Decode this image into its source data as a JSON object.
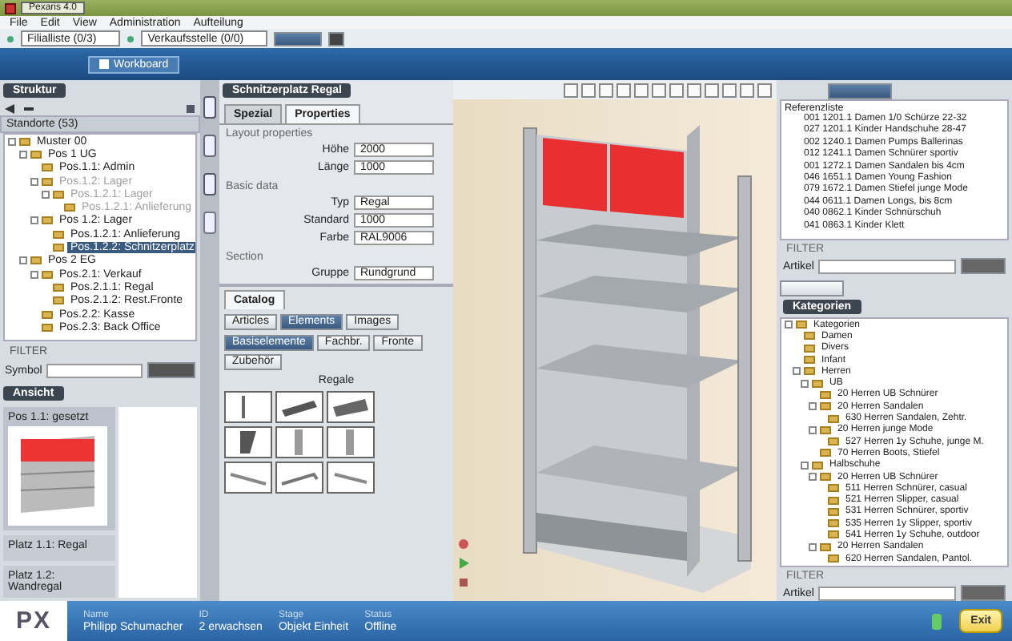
{
  "window": {
    "title": "Pexaris 4.0"
  },
  "menu": [
    "File",
    "Edit",
    "View",
    "Administration",
    "Aufteilung"
  ],
  "toolbar": {
    "dropdowns": [
      "Filialliste (0/3)",
      "Verkaufsstelle (0/0)"
    ],
    "workboard": "Workboard"
  },
  "left_panel": {
    "header": "Struktur",
    "tree_header": "Standorte (53)",
    "tree": [
      {
        "label": "Muster 00",
        "selected": false,
        "disabled": false,
        "children": [
          {
            "label": "Pos 1 UG",
            "selected": false,
            "disabled": false,
            "children": [
              {
                "label": "Pos.1.1: Admin",
                "selected": false,
                "disabled": false
              },
              {
                "label": "Pos.1.2: Lager",
                "selected": false,
                "disabled": true,
                "children": [
                  {
                    "label": "Pos.1.2.1: Lager",
                    "selected": false,
                    "disabled": true,
                    "children": [
                      {
                        "label": "Pos.1.2.1: Anlieferung",
                        "selected": false,
                        "disabled": true
                      }
                    ]
                  }
                ]
              },
              {
                "label": "Pos 1.2: Lager",
                "selected": false,
                "disabled": false,
                "children": [
                  {
                    "label": "Pos.1.2.1: Anlieferung",
                    "selected": false,
                    "disabled": false
                  },
                  {
                    "label": "Pos.1.2.2: Schnitzerplatz",
                    "selected": true,
                    "disabled": false
                  }
                ]
              }
            ]
          },
          {
            "label": "Pos 2 EG",
            "selected": false,
            "disabled": false,
            "children": [
              {
                "label": "Pos.2.1: Verkauf",
                "selected": false,
                "disabled": false,
                "children": [
                  {
                    "label": "Pos.2.1.1: Regal",
                    "selected": false,
                    "disabled": false
                  },
                  {
                    "label": "Pos.2.1.2: Rest.Fronte",
                    "selected": false,
                    "disabled": false
                  }
                ]
              },
              {
                "label": "Pos.2.2: Kasse",
                "selected": false,
                "disabled": false
              },
              {
                "label": "Pos.2.3: Back Office",
                "selected": false,
                "disabled": false
              }
            ]
          }
        ]
      }
    ],
    "filter": {
      "title": "FILTER",
      "label": "Symbol"
    },
    "thumbs_header": "Ansicht",
    "thumbnails": [
      {
        "label": "Pos 1.1: gesetzt",
        "selected": true
      },
      {
        "label": "Platz 1.1: Regal",
        "selected": false
      },
      {
        "label": "Platz 1.2: Wandregal",
        "selected": false
      }
    ]
  },
  "properties": {
    "title": "Schnitzerplatz Regal",
    "tabs": [
      {
        "label": "Spezial",
        "selected": false
      },
      {
        "label": "Properties",
        "selected": true
      }
    ],
    "sections": [
      {
        "title": "Layout properties",
        "fields": [
          {
            "label": "Höhe",
            "value": "2000"
          },
          {
            "label": "Länge",
            "value": "1000"
          }
        ]
      },
      {
        "title": "Basic data",
        "fields": [
          {
            "label": "Typ",
            "value": "Regal"
          },
          {
            "label": "Standard",
            "value": "1000"
          },
          {
            "label": "Farbe",
            "value": "RAL9006"
          }
        ]
      },
      {
        "title": "Section",
        "fields": [
          {
            "label": "Gruppe",
            "value": "Rundgrund"
          }
        ]
      }
    ]
  },
  "catalog": {
    "title": "Catalog",
    "tabs": [
      {
        "label": "Articles",
        "selected": false
      },
      {
        "label": "Elements",
        "selected": true
      },
      {
        "label": "Images",
        "selected": false
      }
    ],
    "filters": [
      {
        "label": "Basiselemente",
        "selected": true
      },
      {
        "label": "Fachbr.",
        "selected": false
      },
      {
        "label": "Fronte",
        "selected": false
      },
      {
        "label": "Zubehör",
        "selected": false
      }
    ],
    "group": "Regale"
  },
  "right_panel": {
    "list_header": "Referenzliste",
    "list": [
      "001 1201.1 Damen 1/0 Schürze 22-32",
      "027 1201.1 Kinder Handschuhe 28-47",
      "002 1240.1 Damen Pumps Ballerinas",
      "012 1241.1 Damen Schnürer sportiv",
      "001 1272.1 Damen Sandalen bis 4cm",
      "046 1651.1 Damen Young Fashion",
      "079 1672.1 Damen Stiefel junge Mode",
      "044 0611.1 Damen Longs, bis 8cm",
      "040 0862.1 Kinder Schnürschuh",
      "041 0863.1 Kinder Klett"
    ],
    "filter": {
      "title": "FILTER",
      "label": "Artikel"
    },
    "categories_header": "Kategorien",
    "categories": [
      {
        "label": "Kategorien",
        "children": [
          {
            "label": "Damen"
          },
          {
            "label": "Divers"
          },
          {
            "label": "Infant"
          },
          {
            "label": "Herren",
            "children": [
              {
                "label": "UB",
                "children": [
                  {
                    "label": "20 Herren UB Schnürer"
                  },
                  {
                    "label": "20 Herren Sandalen",
                    "children": [
                      {
                        "label": "630 Herren Sandalen, Zehtr."
                      }
                    ]
                  },
                  {
                    "label": "20 Herren junge Mode",
                    "children": [
                      {
                        "label": "527 Herren 1y Schuhe, junge M."
                      }
                    ]
                  },
                  {
                    "label": "70 Herren Boots, Stiefel"
                  }
                ]
              },
              {
                "label": "Halbschuhe",
                "children": [
                  {
                    "label": "20 Herren UB Schnürer",
                    "children": [
                      {
                        "label": "511 Herren Schnürer, casual"
                      },
                      {
                        "label": "521 Herren Slipper, casual"
                      },
                      {
                        "label": "531 Herren Schnürer, sportiv"
                      },
                      {
                        "label": "535 Herren 1y Slipper, sportiv"
                      },
                      {
                        "label": "541 Herren 1y Schuhe, outdoor"
                      }
                    ]
                  },
                  {
                    "label": "20 Herren Sandalen",
                    "children": [
                      {
                        "label": "620 Herren Sandalen, Pantol."
                      }
                    ]
                  }
                ]
              }
            ]
          }
        ]
      }
    ],
    "filter2": {
      "title": "FILTER",
      "label": "Artikel"
    }
  },
  "status_bar": {
    "logo": "PX",
    "fields": [
      {
        "label": "Name",
        "value": "Philipp Schumacher"
      },
      {
        "label": "ID",
        "value": "2 erwachsen"
      },
      {
        "label": "Stage",
        "value": "Objekt Einheit"
      },
      {
        "label": "Status",
        "value": "Offline"
      }
    ],
    "exit": "Exit"
  }
}
